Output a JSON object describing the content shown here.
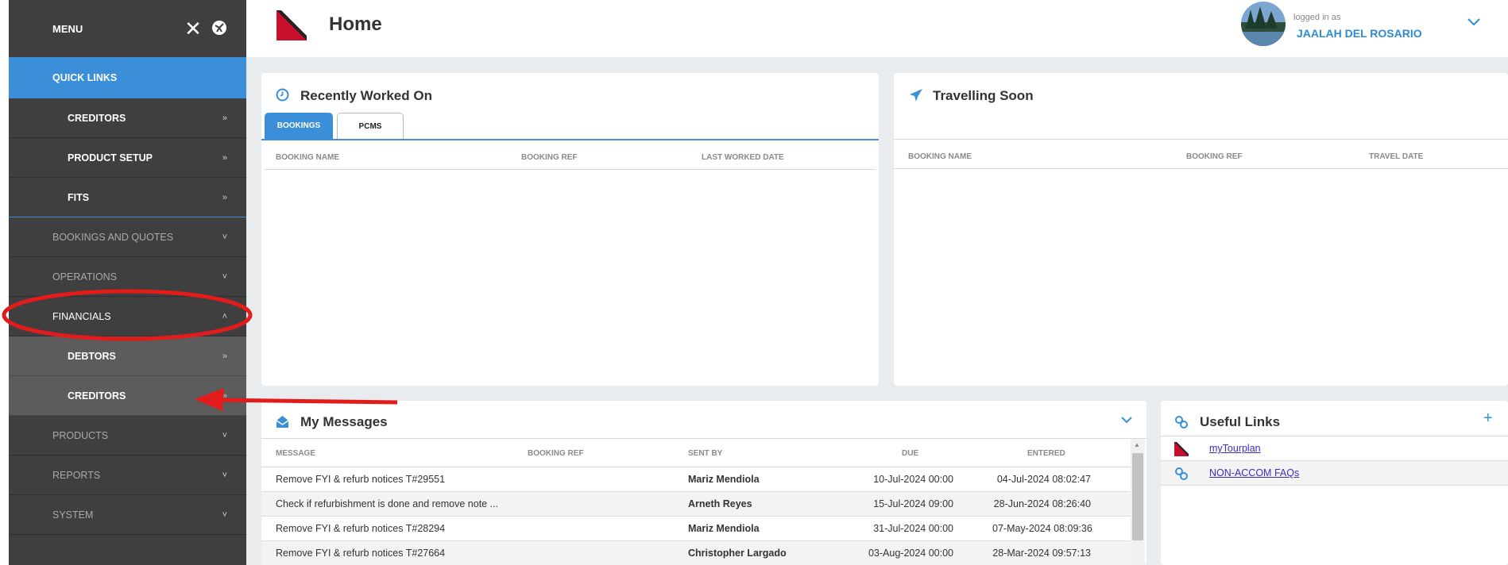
{
  "sidebar": {
    "title": "MENU",
    "quick_links": "QUICK LINKS",
    "quick_items": [
      {
        "label": "CREDITORS"
      },
      {
        "label": "PRODUCT SETUP"
      },
      {
        "label": "FITS"
      }
    ],
    "sections": [
      {
        "label": "BOOKINGS AND QUOTES"
      },
      {
        "label": "OPERATIONS"
      },
      {
        "label": "FINANCIALS"
      }
    ],
    "financial_items": [
      {
        "label": "DEBTORS"
      },
      {
        "label": "CREDITORS"
      }
    ],
    "bottom_sections": [
      {
        "label": "PRODUCTS"
      },
      {
        "label": "REPORTS"
      },
      {
        "label": "SYSTEM"
      }
    ]
  },
  "header": {
    "title": "Home",
    "logged_in_as": "logged in as",
    "user_name": "JAALAH DEL ROSARIO"
  },
  "recent": {
    "title": "Recently Worked On",
    "tabs": [
      {
        "label": "BOOKINGS"
      },
      {
        "label": "PCMS"
      }
    ],
    "columns": [
      "BOOKING NAME",
      "BOOKING REF",
      "LAST WORKED DATE"
    ]
  },
  "travel": {
    "title": "Travelling Soon",
    "columns": [
      "BOOKING NAME",
      "BOOKING REF",
      "TRAVEL DATE"
    ]
  },
  "messages": {
    "title": "My Messages",
    "columns": [
      "MESSAGE",
      "BOOKING REF",
      "SENT BY",
      "DUE",
      "ENTERED"
    ],
    "rows": [
      {
        "message": "Remove FYI & refurb notices T#29551",
        "booking_ref": "",
        "sent_by": "Mariz Mendiola",
        "due": "10-Jul-2024 00:00",
        "entered": "04-Jul-2024 08:02:47"
      },
      {
        "message": "Check if refurbishment is done and remove note ...",
        "booking_ref": "",
        "sent_by": "Arneth Reyes",
        "due": "15-Jul-2024 09:00",
        "entered": "28-Jun-2024 08:26:40"
      },
      {
        "message": "Remove FYI & refurb notices T#28294",
        "booking_ref": "",
        "sent_by": "Mariz Mendiola",
        "due": "31-Jul-2024 00:00",
        "entered": "07-May-2024 08:09:36"
      },
      {
        "message": "Remove FYI & refurb notices T#27664",
        "booking_ref": "",
        "sent_by": "Christopher Largado",
        "due": "03-Aug-2024 00:00",
        "entered": "28-Mar-2024 09:57:13"
      }
    ]
  },
  "links": {
    "title": "Useful Links",
    "add": "+",
    "items": [
      {
        "label": "myTourplan",
        "icon": "tourplan-logo-icon"
      },
      {
        "label": "NON-ACCOM FAQs",
        "icon": "link-icon"
      }
    ]
  },
  "colors": {
    "sidebar_bg": "#3f3f3f",
    "accent": "#3a8fd8",
    "brand_red": "#c8102e",
    "annotation_red": "#e31b1b"
  }
}
